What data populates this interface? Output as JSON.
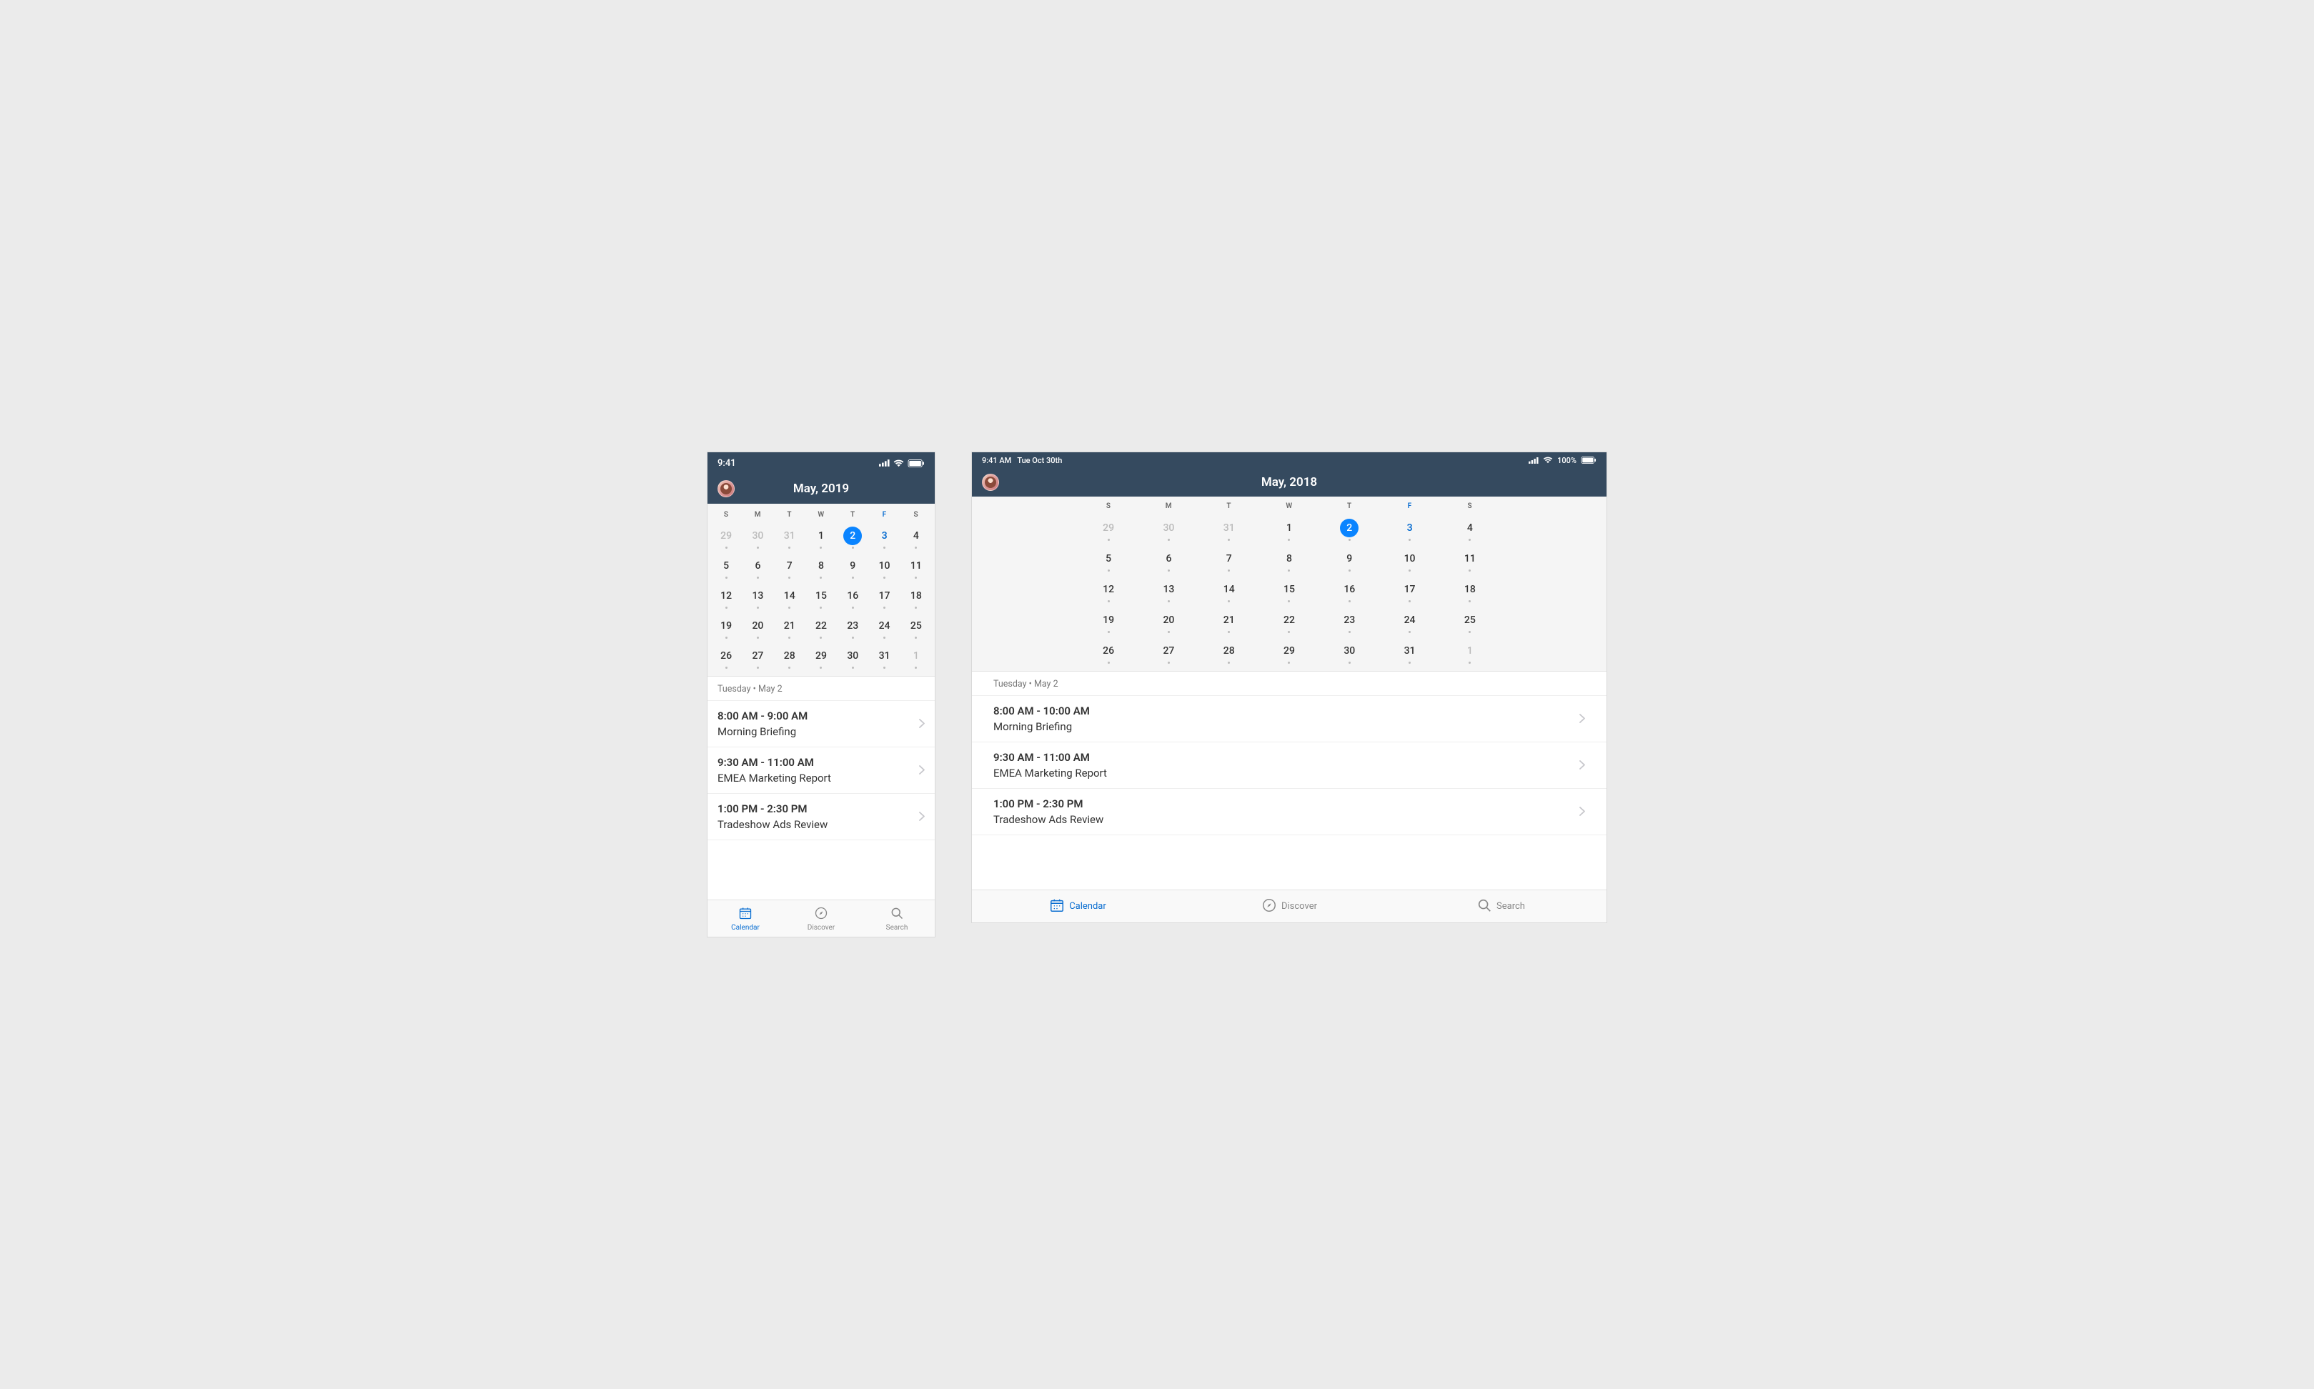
{
  "phone": {
    "status_time": "9:41",
    "header_title": "May, 2019",
    "weekdays": [
      "S",
      "M",
      "T",
      "W",
      "T",
      "F",
      "S"
    ],
    "weekday_accent_index": 5,
    "weeks": [
      [
        {
          "n": "29",
          "muted": true,
          "dot": true
        },
        {
          "n": "30",
          "muted": true,
          "dot": true
        },
        {
          "n": "31",
          "muted": true,
          "dot": true
        },
        {
          "n": "1",
          "dot": true
        },
        {
          "n": "2",
          "dot": true,
          "selected": true
        },
        {
          "n": "3",
          "accent": true,
          "dot": true
        },
        {
          "n": "4",
          "dot": true
        }
      ],
      [
        {
          "n": "5",
          "dot": true
        },
        {
          "n": "6",
          "dot": true
        },
        {
          "n": "7",
          "dot": true
        },
        {
          "n": "8",
          "dot": true
        },
        {
          "n": "9",
          "dot": true
        },
        {
          "n": "10",
          "dot": true
        },
        {
          "n": "11",
          "dot": true
        }
      ],
      [
        {
          "n": "12",
          "dot": true
        },
        {
          "n": "13",
          "dot": true
        },
        {
          "n": "14",
          "dot": true
        },
        {
          "n": "15",
          "dot": true
        },
        {
          "n": "16",
          "dot": true
        },
        {
          "n": "17",
          "dot": true
        },
        {
          "n": "18",
          "dot": true
        }
      ],
      [
        {
          "n": "19",
          "dot": true
        },
        {
          "n": "20",
          "dot": true
        },
        {
          "n": "21",
          "dot": true
        },
        {
          "n": "22",
          "dot": true
        },
        {
          "n": "23",
          "dot": true
        },
        {
          "n": "24",
          "dot": true
        },
        {
          "n": "25",
          "dot": true
        }
      ],
      [
        {
          "n": "26",
          "dot": true
        },
        {
          "n": "27",
          "dot": true
        },
        {
          "n": "28",
          "dot": true
        },
        {
          "n": "29",
          "dot": true
        },
        {
          "n": "30",
          "dot": true
        },
        {
          "n": "31",
          "dot": true
        },
        {
          "n": "1",
          "muted": true,
          "dot": true
        }
      ]
    ],
    "day_label": "Tuesday • May 2",
    "events": [
      {
        "time": "8:00 AM - 9:00 AM",
        "title": "Morning Briefing"
      },
      {
        "time": "9:30 AM - 11:00 AM",
        "title": "EMEA Marketing Report"
      },
      {
        "time": "1:00 PM - 2:30 PM",
        "title": "Tradeshow Ads Review"
      }
    ],
    "tabs": [
      {
        "label": "Calendar",
        "active": true
      },
      {
        "label": "Discover"
      },
      {
        "label": "Search"
      }
    ]
  },
  "tablet": {
    "status_time": "9:41 AM",
    "status_date": "Tue Oct 30th",
    "battery_label": "100%",
    "header_title": "May, 2018",
    "weekdays": [
      "S",
      "M",
      "T",
      "W",
      "T",
      "F",
      "S"
    ],
    "weekday_accent_index": 5,
    "weeks": [
      [
        {
          "n": "29",
          "muted": true,
          "dot": true
        },
        {
          "n": "30",
          "muted": true,
          "dot": true
        },
        {
          "n": "31",
          "muted": true,
          "dot": true
        },
        {
          "n": "1",
          "dot": true
        },
        {
          "n": "2",
          "dot": true,
          "selected": true
        },
        {
          "n": "3",
          "accent": true,
          "dot": true
        },
        {
          "n": "4",
          "dot": true
        }
      ],
      [
        {
          "n": "5",
          "dot": true
        },
        {
          "n": "6",
          "dot": true
        },
        {
          "n": "7",
          "dot": true
        },
        {
          "n": "8",
          "dot": true
        },
        {
          "n": "9",
          "dot": true
        },
        {
          "n": "10",
          "dot": true
        },
        {
          "n": "11",
          "dot": true
        }
      ],
      [
        {
          "n": "12",
          "dot": true
        },
        {
          "n": "13",
          "dot": true
        },
        {
          "n": "14",
          "dot": true
        },
        {
          "n": "15",
          "dot": true
        },
        {
          "n": "16",
          "dot": true
        },
        {
          "n": "17",
          "dot": true
        },
        {
          "n": "18",
          "dot": true
        }
      ],
      [
        {
          "n": "19",
          "dot": true
        },
        {
          "n": "20",
          "dot": true
        },
        {
          "n": "21",
          "dot": true
        },
        {
          "n": "22",
          "dot": true
        },
        {
          "n": "23",
          "dot": true
        },
        {
          "n": "24",
          "dot": true
        },
        {
          "n": "25",
          "dot": true
        }
      ],
      [
        {
          "n": "26",
          "dot": true
        },
        {
          "n": "27",
          "dot": true
        },
        {
          "n": "28",
          "dot": true
        },
        {
          "n": "29",
          "dot": true
        },
        {
          "n": "30",
          "dot": true
        },
        {
          "n": "31",
          "dot": true
        },
        {
          "n": "1",
          "muted": true,
          "dot": true
        }
      ]
    ],
    "day_label": "Tuesday • May 2",
    "events": [
      {
        "time": "8:00 AM - 10:00 AM",
        "title": "Morning Briefing"
      },
      {
        "time": "9:30 AM - 11:00 AM",
        "title": "EMEA Marketing Report"
      },
      {
        "time": "1:00 PM - 2:30 PM",
        "title": "Tradeshow Ads Review"
      }
    ],
    "tabs": [
      {
        "label": "Calendar",
        "active": true
      },
      {
        "label": "Discover"
      },
      {
        "label": "Search"
      }
    ]
  }
}
